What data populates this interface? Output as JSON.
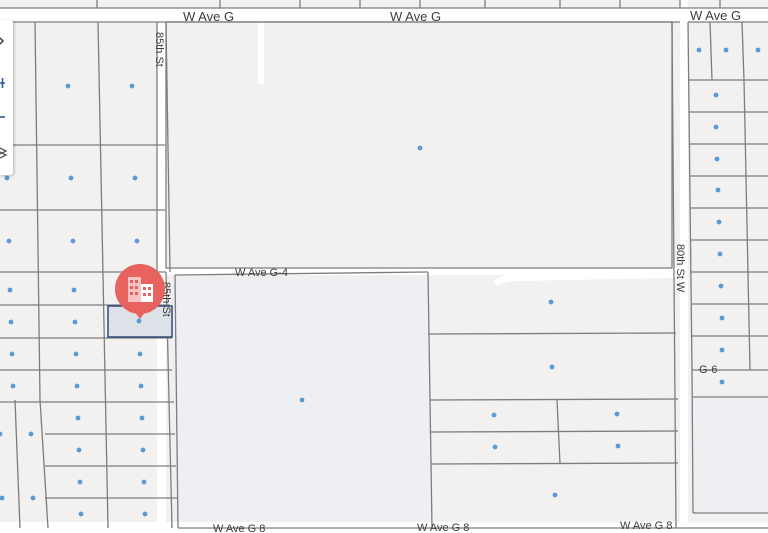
{
  "streets": {
    "w_ave_g": "W Ave G",
    "w_ave_g_4": "W Ave G-4",
    "w_ave_g_8": "W Ave G 8",
    "st_85th": "85th St",
    "st_80th": "80th St W",
    "g6": "G-6"
  },
  "marker": {
    "icon": "building-icon",
    "color": "#e8625f"
  },
  "toolbar": {
    "items": [
      {
        "icon": "chevron-icon"
      },
      {
        "icon": "zoom-in-icon"
      },
      {
        "icon": "zoom-out-icon"
      },
      {
        "icon": "layers-icon"
      }
    ]
  },
  "colors": {
    "background": "#f2f1f0",
    "parcel_border": "#7d7d7d",
    "parcel_dot": "#5b9bd5",
    "selected_parcel_fill": "#dde1e8",
    "selected_parcel_border": "#2e4a7a",
    "road": "#ffffff"
  }
}
